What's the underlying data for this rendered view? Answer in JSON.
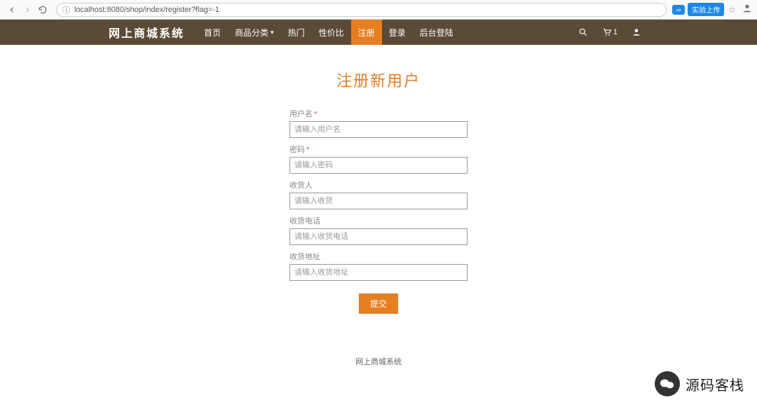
{
  "browser": {
    "url": "localhost:8080/shop/index/register?flag=-1",
    "extension_label": "实验上传"
  },
  "header": {
    "brand": "网上商城系统",
    "nav": [
      {
        "label": "首页",
        "active": false,
        "dropdown": false
      },
      {
        "label": "商品分类",
        "active": false,
        "dropdown": true
      },
      {
        "label": "热门",
        "active": false,
        "dropdown": false
      },
      {
        "label": "性价比",
        "active": false,
        "dropdown": false
      },
      {
        "label": "注册",
        "active": true,
        "dropdown": false
      },
      {
        "label": "登录",
        "active": false,
        "dropdown": false
      },
      {
        "label": "后台登陆",
        "active": false,
        "dropdown": false
      }
    ],
    "cart_count": "1"
  },
  "page": {
    "title": "注册新用户",
    "fields": [
      {
        "label": "用户名",
        "required": true,
        "placeholder": "请输入用户名"
      },
      {
        "label": "密码",
        "required": true,
        "placeholder": "请输入密码"
      },
      {
        "label": "收货人",
        "required": false,
        "placeholder": "请输入收货"
      },
      {
        "label": "收货电话",
        "required": false,
        "placeholder": "请输入收货电话"
      },
      {
        "label": "收货地址",
        "required": false,
        "placeholder": "请输入收货地址"
      }
    ],
    "submit_label": "提交"
  },
  "footer": {
    "text": "网上商城系统"
  },
  "watermark": {
    "text": "源码客栈"
  }
}
